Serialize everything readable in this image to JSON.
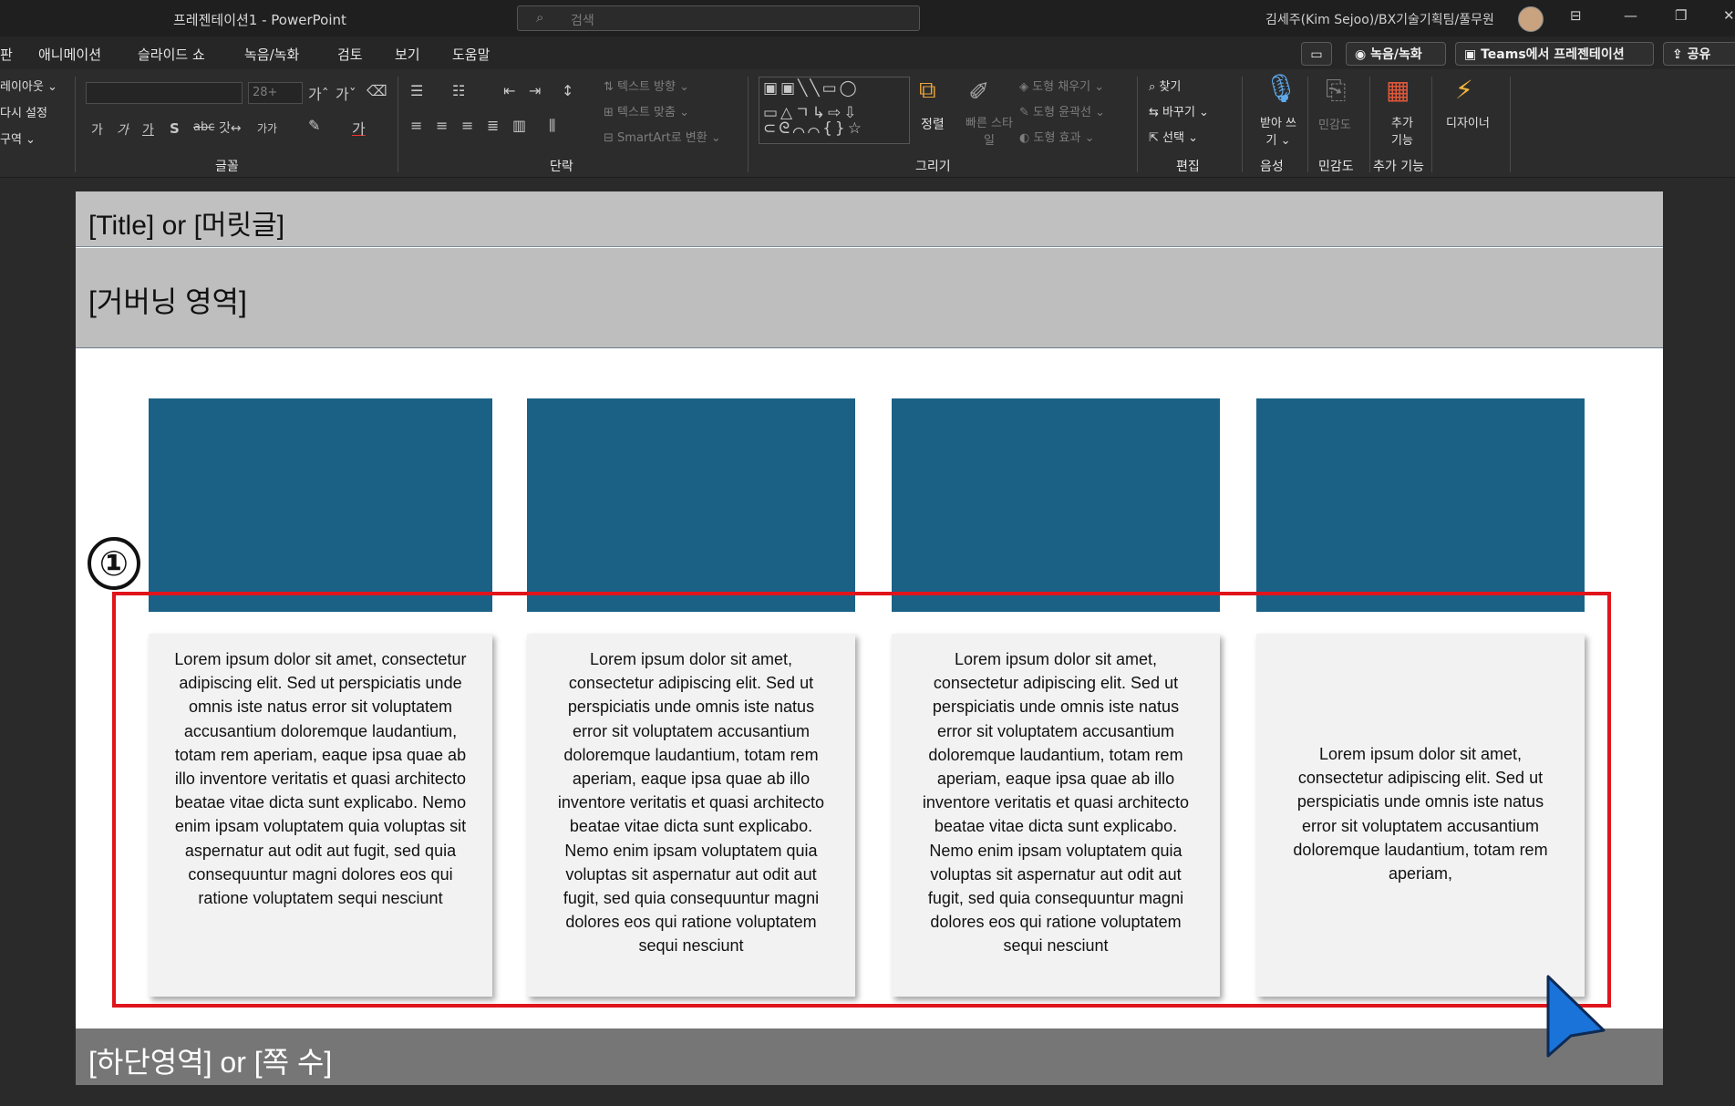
{
  "window": {
    "title": "프레젠테이션1  -  PowerPoint",
    "search_placeholder": "검색",
    "user": "김세주(Kim Sejoo)/BX기술기획팀/풀무원"
  },
  "menu": {
    "items": [
      "판",
      "애니메이션",
      "슬라이드 쇼",
      "녹음/녹화",
      "검토",
      "보기",
      "도움말"
    ],
    "comment_icon": "comment-icon",
    "record_label": "◉ 녹음/녹화",
    "teams_label": "Teams에서 프레젠테이션",
    "share_label": "⇪ 공유"
  },
  "ribbon": {
    "slides_group": [
      "레이아웃 ⌄",
      "다시 설정",
      "구역 ⌄"
    ],
    "font_size_value": "28+",
    "font_group_label": "글꼴",
    "paragraph_group_label": "단락",
    "text_direction": "텍스트 방향 ⌄",
    "text_align": "텍스트 맞춤 ⌄",
    "smartart": "SmartArt로 변환 ⌄",
    "drawing_group_label": "그리기",
    "arrange": "정렬",
    "quick_styles": "빠른 스타일",
    "shape_fill": "도형 채우기 ⌄",
    "shape_outline": "도형 윤곽선 ⌄",
    "shape_effects": "도형 효과 ⌄",
    "find": "찾기",
    "replace": "바꾸기 ⌄",
    "select": "선택 ⌄",
    "editing_group_label": "편집",
    "dictate": "받아 쓰기 ⌄",
    "voice_group_label": "음성",
    "sensitivity": "민감도",
    "sensitivity_group_label": "민감도",
    "addins": "추가 기능",
    "addins_group_label": "추가 기능",
    "designer": "디자이너"
  },
  "slide": {
    "title_placeholder": "[Title] or [머릿글]",
    "governing_placeholder": "[거버닝 영역]",
    "footer_placeholder": "[하단영역] or [쪽 수]",
    "badge": "①",
    "card_text_long": "Lorem ipsum dolor sit amet, consectetur adipiscing elit. Sed ut perspiciatis unde omnis iste natus error sit voluptatem accusantium doloremque laudantium, totam rem aperiam, eaque ipsa quae ab illo inventore veritatis et quasi architecto beatae vitae dicta sunt explicabo. Nemo enim ipsam voluptatem quia voluptas sit aspernatur aut odit aut fugit, sed quia consequuntur magni dolores eos qui ratione voluptatem sequi nesciunt",
    "card_text_short": "Lorem ipsum dolor sit amet, consectetur adipiscing elit. Sed ut perspiciatis unde omnis iste natus error sit voluptatem accusantium doloremque laudantium, totam rem aperiam,"
  },
  "colors": {
    "image_placeholder": "#1b6186",
    "highlight": "#e0141b",
    "cursor": "#1a73d9"
  }
}
